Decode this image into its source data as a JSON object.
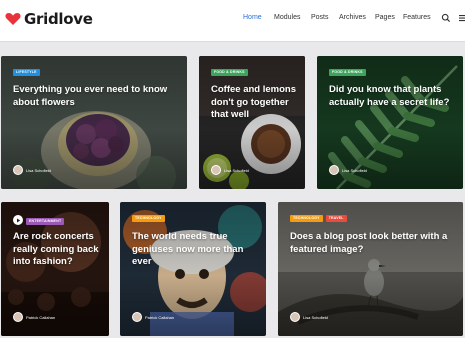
{
  "site": {
    "name": "Gridlove"
  },
  "nav": {
    "items": [
      "Home",
      "Modules",
      "Posts",
      "Archives",
      "Pages",
      "Features"
    ],
    "active": "Home",
    "icons": [
      "search-icon",
      "menu-icon"
    ]
  },
  "colors": {
    "brand": "#e8323c",
    "nav_active": "#2b6fd6",
    "badge_blue": "#1e8fe1",
    "badge_green": "#3ba55c",
    "badge_purple": "#9b59b6",
    "badge_orange": "#f39c12",
    "badge_red": "#e74c3c"
  },
  "cards": [
    {
      "badges": [
        {
          "label": "Lifestyle",
          "color": "#1e8fe1"
        }
      ],
      "title": "Everything you ever need to know about flowers",
      "author": "Lisa Schofield"
    },
    {
      "badges": [
        {
          "label": "Food & Drinks",
          "color": "#3ba55c"
        }
      ],
      "title": "Coffee and lemons don't go together that well",
      "author": "Lisa Schofield"
    },
    {
      "badges": [
        {
          "label": "Food & Drinks",
          "color": "#3ba55c"
        }
      ],
      "title": "Did you know that plants actually have a secret life?",
      "author": "Lisa Schofield"
    },
    {
      "badges": [
        {
          "label": "Entertainment",
          "color": "#9b59b6"
        }
      ],
      "title": "Are rock concerts really coming back into fashion?",
      "author": "Patrick Callahan"
    },
    {
      "badges": [
        {
          "label": "Technology",
          "color": "#f39c12"
        }
      ],
      "title": "The world needs true geniuses now more than ever",
      "author": "Patrick Callahan"
    },
    {
      "badges": [
        {
          "label": "Technology",
          "color": "#f39c12"
        },
        {
          "label": "Travel",
          "color": "#e74c3c"
        }
      ],
      "title": "Does a blog post look better with a featured image?",
      "author": "Lisa Schofield"
    }
  ]
}
